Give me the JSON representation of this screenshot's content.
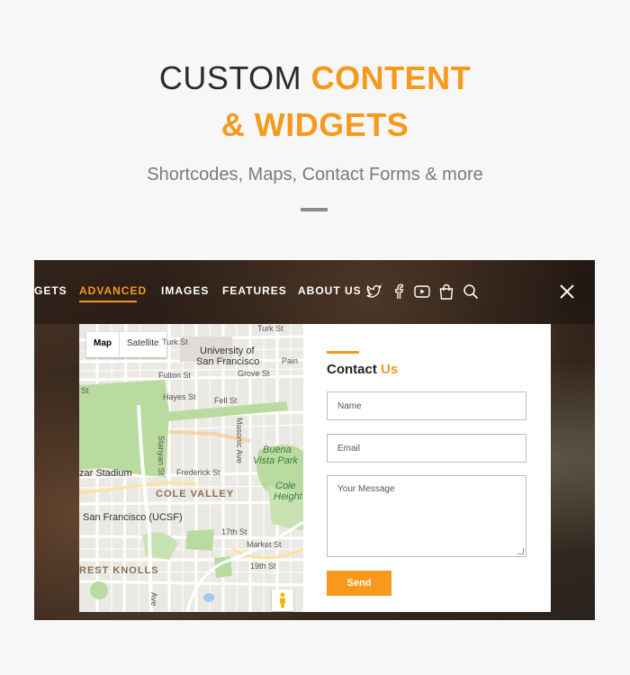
{
  "hero": {
    "title_plain": "CUSTOM ",
    "title_accent": "CONTENT",
    "title_line2": "& WIDGETS",
    "subtitle": "Shortcodes, Maps, Contact Forms & more"
  },
  "nav": {
    "items": [
      "GETS",
      "ADVANCED",
      "IMAGES",
      "FEATURES",
      "ABOUT US"
    ],
    "active": "ADVANCED",
    "icons": [
      "twitter-icon",
      "facebook-icon",
      "youtube-icon",
      "shopping-bag-icon",
      "search-icon"
    ],
    "close_icon": "close-icon"
  },
  "map": {
    "toggle": {
      "map": "Map",
      "satellite": "Satellite"
    },
    "labels": {
      "turk": "Turk St",
      "university": "University of",
      "university2": "San Francisco",
      "park": "Park",
      "palm": "Pain",
      "fulton": "Fulton St",
      "grove": "Grove St",
      "st": "St",
      "hayes": "Hayes St",
      "fell": "Fell St",
      "stanyan": "Stanyan St",
      "masonic": "Masonic Ave",
      "buena": "Buena",
      "vista": "Vista Park",
      "stadium": "zar Stadium",
      "frederick": "Frederick St",
      "cole": "COLE VALLEY",
      "cole_h": "Cole",
      "height": "Height",
      "ucsf": "San Francisco (UCSF)",
      "seventeenth": "17th St",
      "market": "Market St",
      "nineteenth": "19th St",
      "forest": "REST KNOLLS",
      "ave": "Ave"
    },
    "pegman_icon": "pegman-icon",
    "colors": {
      "park": "#b9dba0",
      "road": "#ffffff",
      "major_road": "#fde29a",
      "water": "#a5c8ef"
    }
  },
  "contact": {
    "title_plain": "Contact ",
    "title_accent": "Us",
    "name_placeholder": "Name",
    "email_placeholder": "Email",
    "message_placeholder": "Your Message",
    "send_label": "Send"
  },
  "colors": {
    "accent": "#f7991c",
    "text_dark": "#2b2b2b",
    "subtitle": "#7a7a7a"
  }
}
